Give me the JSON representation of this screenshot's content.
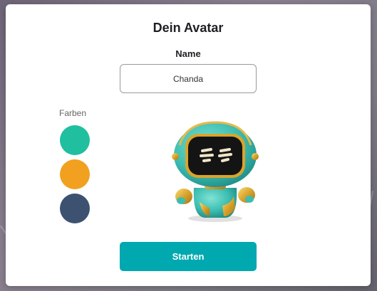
{
  "dialog": {
    "title": "Dein Avatar",
    "name_label": "Name",
    "name_value": "Chanda",
    "colors_label": "Farben",
    "colors": [
      "#1fbf9f",
      "#f2a01f",
      "#3d5270"
    ],
    "start_label": "Starten"
  }
}
